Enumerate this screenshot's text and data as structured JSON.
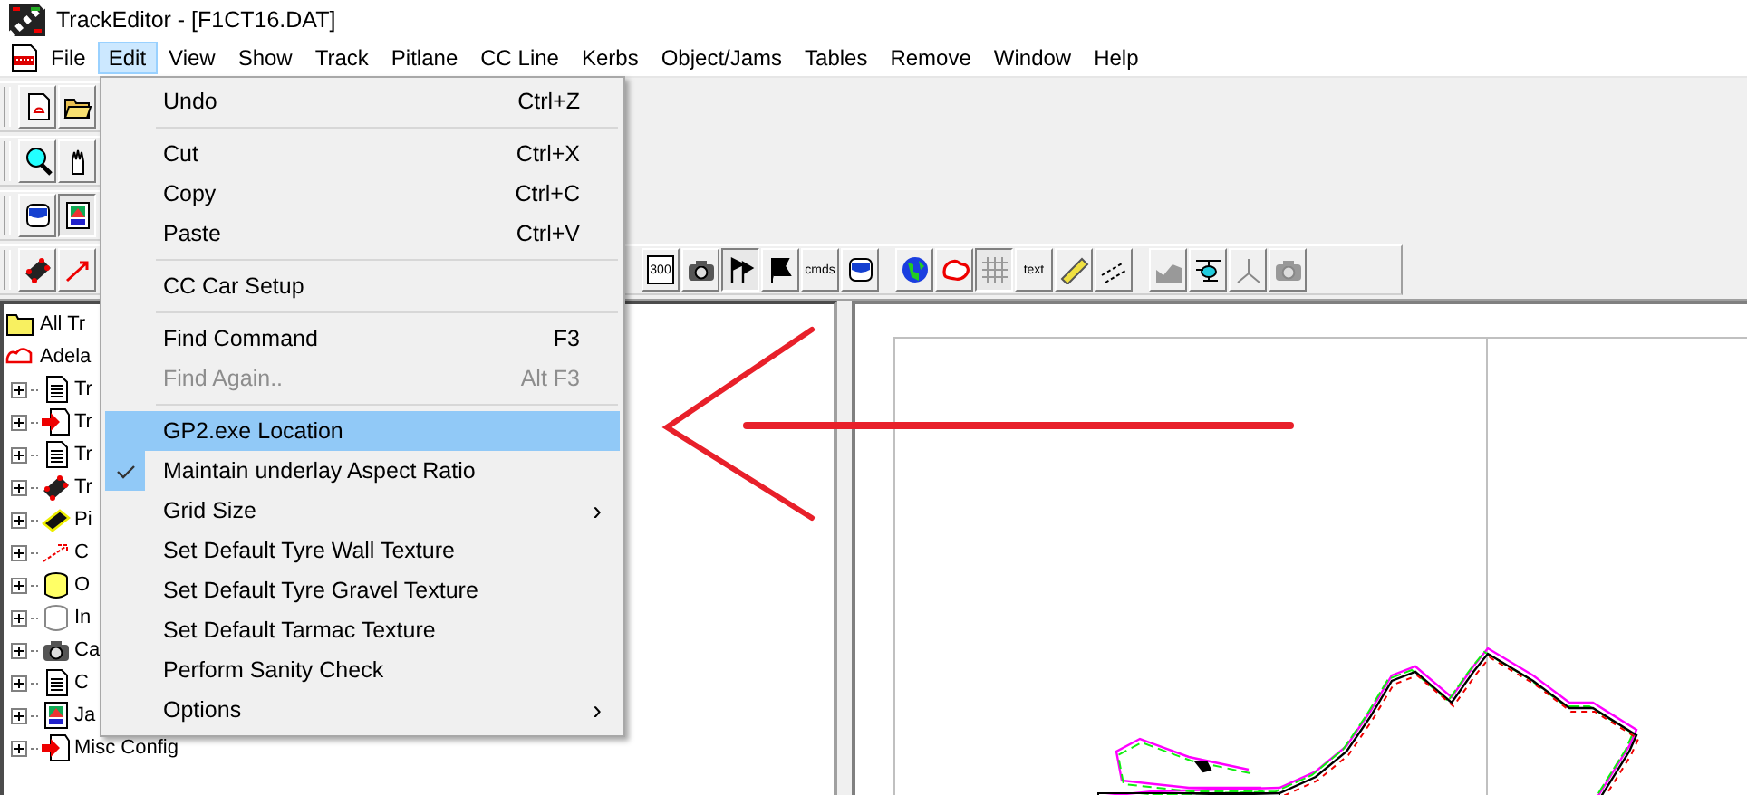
{
  "window": {
    "title": "TrackEditor - [F1CT16.DAT]"
  },
  "menus": [
    {
      "label": "File",
      "selected": false
    },
    {
      "label": "Edit",
      "selected": true
    },
    {
      "label": "View",
      "selected": false
    },
    {
      "label": "Show",
      "selected": false
    },
    {
      "label": "Track",
      "selected": false
    },
    {
      "label": "Pitlane",
      "selected": false
    },
    {
      "label": "CC Line",
      "selected": false
    },
    {
      "label": "Kerbs",
      "selected": false
    },
    {
      "label": "Object/Jams",
      "selected": false
    },
    {
      "label": "Tables",
      "selected": false
    },
    {
      "label": "Remove",
      "selected": false
    },
    {
      "label": "Window",
      "selected": false
    },
    {
      "label": "Help",
      "selected": false
    }
  ],
  "toolbars": [
    {
      "groups": [
        [
          {
            "kind": "new-doc",
            "pressed": false
          },
          {
            "kind": "open-folder",
            "pressed": false
          }
        ]
      ]
    },
    {
      "groups": [
        [
          {
            "kind": "magnifier",
            "pressed": false
          },
          {
            "kind": "hand",
            "pressed": false
          }
        ]
      ]
    },
    {
      "groups": [
        [
          {
            "kind": "cylinder",
            "pressed": false
          },
          {
            "kind": "image",
            "pressed": true
          }
        ]
      ]
    },
    {
      "groups": [
        [
          {
            "kind": "car",
            "pressed": false
          },
          {
            "kind": "arrow",
            "pressed": false
          }
        ],
        [
          {
            "kind": "sign",
            "label": "300",
            "pressed": false
          },
          {
            "kind": "camera",
            "pressed": false
          },
          {
            "kind": "flags",
            "pressed": true
          },
          {
            "kind": "flag",
            "pressed": false
          },
          {
            "kind": "text",
            "label": "cmds",
            "pressed": false
          },
          {
            "kind": "cylinder",
            "pressed": false
          }
        ],
        [
          {
            "kind": "globe",
            "pressed": false
          },
          {
            "kind": "track",
            "pressed": false
          },
          {
            "kind": "grid",
            "pressed": true
          },
          {
            "kind": "text",
            "label": "text",
            "pressed": false
          },
          {
            "kind": "ruler",
            "pressed": false
          },
          {
            "kind": "dashed",
            "pressed": false
          }
        ],
        [
          {
            "kind": "chart-grey",
            "pressed": false
          },
          {
            "kind": "helicopter",
            "pressed": false
          },
          {
            "kind": "axes",
            "pressed": false
          },
          {
            "kind": "camera-grey",
            "pressed": false
          }
        ]
      ]
    }
  ],
  "tree": [
    {
      "label": "All Tr",
      "kind": "folder"
    },
    {
      "label": "Adela",
      "kind": "track",
      "children": [
        {
          "label": "Tr",
          "kind": "document",
          "expanded": false
        },
        {
          "label": "Tr",
          "kind": "arrow-doc",
          "expanded": false
        },
        {
          "label": "Tr",
          "kind": "document",
          "expanded": false
        },
        {
          "label": "Tr",
          "kind": "car",
          "expanded": false
        },
        {
          "label": "Pi",
          "kind": "chip",
          "expanded": false
        },
        {
          "label": "C",
          "kind": "line",
          "expanded": false
        },
        {
          "label": "O",
          "kind": "cylinder",
          "expanded": false
        },
        {
          "label": "In",
          "kind": "cylinder-empty",
          "expanded": false
        },
        {
          "label": "Ca",
          "kind": "camera",
          "expanded": false
        },
        {
          "label": "C",
          "kind": "document",
          "expanded": false
        },
        {
          "label": "Ja",
          "kind": "image",
          "expanded": false
        },
        {
          "label": "Misc Config",
          "kind": "arrow-doc",
          "expanded": false
        }
      ]
    }
  ],
  "edit_menu": [
    {
      "kind": "command",
      "label": "Undo",
      "shortcut": "Ctrl+Z",
      "checked": false,
      "disabled": false,
      "selected": false
    },
    {
      "kind": "separator"
    },
    {
      "kind": "command",
      "label": "Cut",
      "shortcut": "Ctrl+X",
      "checked": false,
      "disabled": false,
      "selected": false
    },
    {
      "kind": "command",
      "label": "Copy",
      "shortcut": "Ctrl+C",
      "checked": false,
      "disabled": false,
      "selected": false
    },
    {
      "kind": "command",
      "label": "Paste",
      "shortcut": "Ctrl+V",
      "checked": false,
      "disabled": false,
      "selected": false
    },
    {
      "kind": "separator"
    },
    {
      "kind": "command",
      "label": "CC Car Setup",
      "checked": false,
      "disabled": false,
      "selected": false
    },
    {
      "kind": "separator"
    },
    {
      "kind": "command",
      "label": "Find Command",
      "shortcut": "F3",
      "checked": false,
      "disabled": false,
      "selected": false
    },
    {
      "kind": "command",
      "label": "Find Again..",
      "shortcut": "Alt F3",
      "checked": false,
      "disabled": true,
      "selected": false
    },
    {
      "kind": "separator"
    },
    {
      "kind": "command",
      "label": "GP2.exe Location",
      "checked": false,
      "disabled": false,
      "selected": true
    },
    {
      "kind": "command",
      "label": "Maintain underlay Aspect Ratio",
      "checked": true,
      "disabled": false,
      "selected": false
    },
    {
      "kind": "submenu",
      "label": "Grid Size",
      "arrow": "›",
      "checked": false,
      "disabled": false,
      "selected": false
    },
    {
      "kind": "command",
      "label": "Set Default Tyre Wall Texture",
      "checked": false,
      "disabled": false,
      "selected": false
    },
    {
      "kind": "command",
      "label": "Set Default Tyre Gravel Texture",
      "checked": false,
      "disabled": false,
      "selected": false
    },
    {
      "kind": "command",
      "label": "Set Default Tarmac Texture",
      "checked": false,
      "disabled": false,
      "selected": false
    },
    {
      "kind": "command",
      "label": "Perform Sanity Check",
      "checked": false,
      "disabled": false,
      "selected": false
    },
    {
      "kind": "submenu",
      "label": "Options",
      "arrow": "›",
      "checked": false,
      "disabled": false,
      "selected": false
    }
  ]
}
